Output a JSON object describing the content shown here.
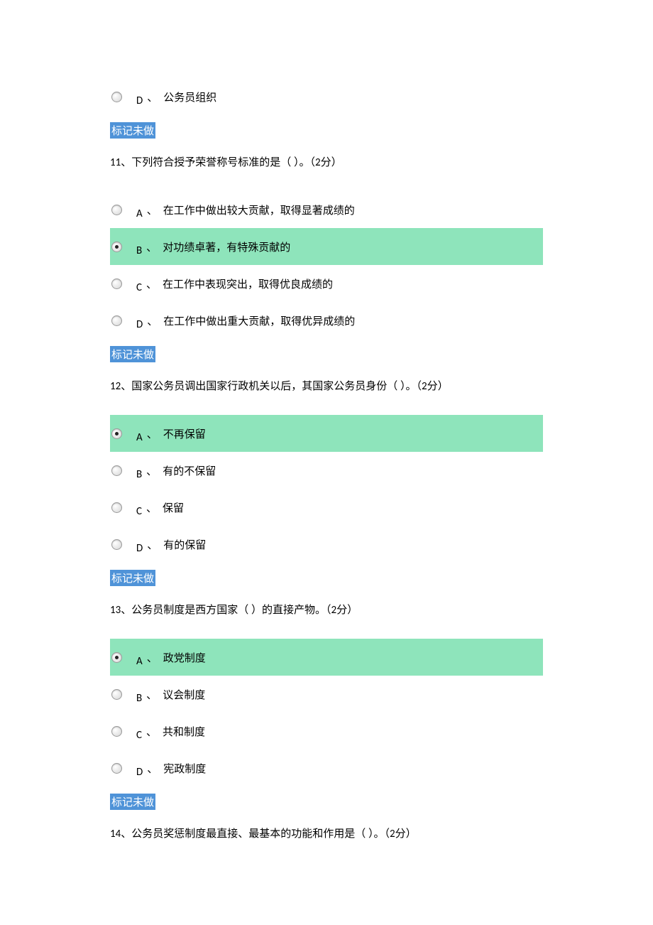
{
  "mark_label": "标记未做",
  "sep": "、",
  "q10_remainder": {
    "options": [
      {
        "letter": "D",
        "text": "公务员组织",
        "selected": false
      }
    ]
  },
  "questions": [
    {
      "num": "11",
      "text": "下列符合授予荣誉称号标准的是（ ）。",
      "pts_open": "（",
      "pts_num": "2",
      "pts_unit": "分）",
      "options": [
        {
          "letter": "A",
          "text": "在工作中做出较大贡献，取得显著成绩的",
          "selected": false
        },
        {
          "letter": "B",
          "text": "对功绩卓著，有特殊贡献的",
          "selected": true
        },
        {
          "letter": "C",
          "text": "在工作中表现突出，取得优良成绩的",
          "selected": false
        },
        {
          "letter": "D",
          "text": "在工作中做出重大贡献，取得优异成绩的",
          "selected": false
        }
      ]
    },
    {
      "num": "12",
      "text": "国家公务员调出国家行政机关以后，其国家公务员身份（ ）。",
      "pts_open": "（",
      "pts_num": "2",
      "pts_unit": "分）",
      "options": [
        {
          "letter": "A",
          "text": "不再保留",
          "selected": true
        },
        {
          "letter": "B",
          "text": "有的不保留",
          "selected": false
        },
        {
          "letter": "C",
          "text": "保留",
          "selected": false
        },
        {
          "letter": "D",
          "text": "有的保留",
          "selected": false
        }
      ]
    },
    {
      "num": "13",
      "text": "公务员制度是西方国家（ ）的直接产物。",
      "pts_open": "（",
      "pts_num": "2",
      "pts_unit": "分）",
      "options": [
        {
          "letter": "A",
          "text": "政党制度",
          "selected": true
        },
        {
          "letter": "B",
          "text": "议会制度",
          "selected": false
        },
        {
          "letter": "C",
          "text": "共和制度",
          "selected": false
        },
        {
          "letter": "D",
          "text": "宪政制度",
          "selected": false
        }
      ]
    },
    {
      "num": "14",
      "text": "公务员奖惩制度最直接、最基本的功能和作用是（ ）。",
      "pts_open": "（",
      "pts_num": "2",
      "pts_unit": "分）",
      "options": []
    }
  ]
}
